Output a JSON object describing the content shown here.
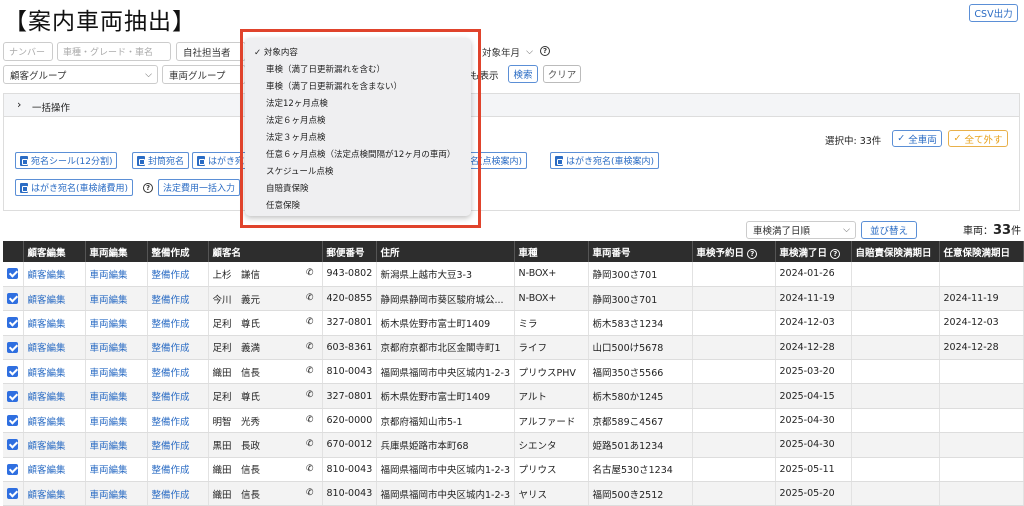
{
  "page": {
    "title": "【案内車両抽出】",
    "csv_button": "CSV出力"
  },
  "filters": {
    "number_placeholder": "ナンバー",
    "car_placeholder": "車種・グレード・車名",
    "staff_label": "自社担当者",
    "target_month": "対象年月",
    "customer_group": "顧客グループ",
    "vehicle_group": "車両グループ",
    "show_label_partial": "も表示",
    "search_button": "検索",
    "clear_button": "クリア"
  },
  "bulk": {
    "toggle_label": "一括操作",
    "selected_label": "選択中: 33件",
    "all_vehicles_button": "全車両",
    "all_remove_button": "全て外す",
    "print_buttons": [
      "宛名シール(12分割)",
      "封筒宛名",
      "はがき宛",
      "宛名(点検案内)",
      "はがき宛名(車検案内)",
      "はがき宛名(車検諸費用)"
    ],
    "fee_button": "法定費用一括入力"
  },
  "dropdown": {
    "items": [
      {
        "label": "対象内容",
        "checked": true
      },
      {
        "label": "車検（満了日更新漏れを含む）",
        "checked": false
      },
      {
        "label": "車検（満了日更新漏れを含まない）",
        "checked": false
      },
      {
        "label": "法定12ヶ月点検",
        "checked": false
      },
      {
        "label": "法定６ヶ月点検",
        "checked": false
      },
      {
        "label": "法定３ヶ月点検",
        "checked": false
      },
      {
        "label": "任意６ヶ月点検（法定点検間隔が12ヶ月の車両）",
        "checked": false
      },
      {
        "label": "スケジュール点検",
        "checked": false
      },
      {
        "label": "自賠責保険",
        "checked": false
      },
      {
        "label": "任意保険",
        "checked": false
      }
    ]
  },
  "sort": {
    "select_value": "車検満了日順",
    "sort_button": "並び替え",
    "count_label": "車両：",
    "count_value": "33",
    "count_suffix": "件"
  },
  "table": {
    "headers": [
      "",
      "顧客編集",
      "車両編集",
      "整備作成",
      "顧客名",
      "郵便番号",
      "住所",
      "車種",
      "車両番号",
      "車検予約日",
      "車検満了日",
      "自賠責保険満期日",
      "任意保険満期日"
    ],
    "rows": [
      [
        "顧客編集",
        "車両編集",
        "整備作成",
        "上杉　謙信",
        "943-0802",
        "新潟県上越市大豆3-3",
        "N-BOX+",
        "静岡300さ701",
        "",
        "2024-01-26",
        "",
        ""
      ],
      [
        "顧客編集",
        "車両編集",
        "整備作成",
        "今川　義元",
        "420-0855",
        "静岡県静岡市葵区駿府城公...",
        "N-BOX+",
        "静岡300さ701",
        "",
        "2024-11-19",
        "",
        "2024-11-19"
      ],
      [
        "顧客編集",
        "車両編集",
        "整備作成",
        "足利　尊氏",
        "327-0801",
        "栃木県佐野市富士町1409",
        "ミラ",
        "栃木583さ1234",
        "",
        "2024-12-03",
        "",
        "2024-12-03"
      ],
      [
        "顧客編集",
        "車両編集",
        "整備作成",
        "足利　義満",
        "603-8361",
        "京都府京都市北区金閣寺町1",
        "ライフ",
        "山口500け5678",
        "",
        "2024-12-28",
        "",
        "2024-12-28"
      ],
      [
        "顧客編集",
        "車両編集",
        "整備作成",
        "織田　信長",
        "810-0043",
        "福岡県福岡市中央区城内1-2-3",
        "プリウスPHV",
        "福岡350さ5566",
        "",
        "2025-03-20",
        "",
        ""
      ],
      [
        "顧客編集",
        "車両編集",
        "整備作成",
        "足利　尊氏",
        "327-0801",
        "栃木県佐野市富士町1409",
        "アルト",
        "栃木580か1245",
        "",
        "2025-04-15",
        "",
        ""
      ],
      [
        "顧客編集",
        "車両編集",
        "整備作成",
        "明智　光秀",
        "620-0000",
        "京都府福知山市5-1",
        "アルファード",
        "京都589こ4567",
        "",
        "2025-04-30",
        "",
        ""
      ],
      [
        "顧客編集",
        "車両編集",
        "整備作成",
        "黒田　長政",
        "670-0012",
        "兵庫県姫路市本町68",
        "シエンタ",
        "姫路501あ1234",
        "",
        "2025-04-30",
        "",
        ""
      ],
      [
        "顧客編集",
        "車両編集",
        "整備作成",
        "織田　信長",
        "810-0043",
        "福岡県福岡市中央区城内1-2-3",
        "プリウス",
        "名古屋530さ1234",
        "",
        "2025-05-11",
        "",
        ""
      ],
      [
        "顧客編集",
        "車両編集",
        "整備作成",
        "織田　信長",
        "810-0043",
        "福岡県福岡市中央区城内1-2-3",
        "ヤリス",
        "福岡500き2512",
        "",
        "2025-05-20",
        "",
        ""
      ]
    ]
  },
  "colors": {
    "accent": "#2b6cc4",
    "header_bg": "#2d2d2d",
    "highlight": "#e0432c",
    "warn": "#e8a21a"
  }
}
